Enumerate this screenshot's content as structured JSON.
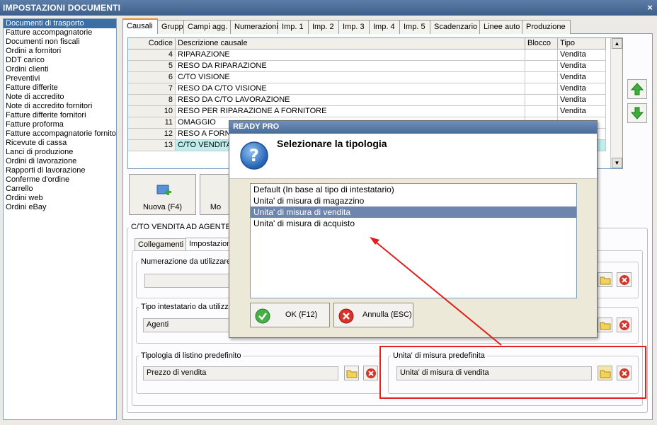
{
  "window": {
    "title": "IMPOSTAZIONI DOCUMENTI",
    "close_glyph": "×"
  },
  "sidebar": {
    "items": [
      "Documenti di trasporto",
      "Fatture accompagnatorie",
      "Documenti non fiscali",
      "Ordini a fornitori",
      "DDT carico",
      "Ordini clienti",
      "Preventivi",
      "Fatture differite",
      "Note di accredito",
      "Note di accredito fornitori",
      "Fatture differite fornitori",
      "Fatture proforma",
      "Fatture accompagnatorie fornitori",
      "Ricevute di cassa",
      "Lanci di produzione",
      "Ordini di lavorazione",
      "Rapporti di lavorazione",
      "Conferme d'ordine",
      "Carrello",
      "Ordini web",
      "Ordini eBay"
    ],
    "selected": "Documenti di trasporto"
  },
  "tabs": [
    "Causali",
    "Gruppi",
    "Campi agg.",
    "Numerazioni",
    "Imp. 1",
    "Imp. 2",
    "Imp. 3",
    "Imp. 4",
    "Imp. 5",
    "Scadenzario",
    "Linee auto",
    "Produzione"
  ],
  "active_tab": "Causali",
  "grid": {
    "headers": {
      "codice": "Codice",
      "descrizione": "Descrizione causale",
      "blocco": "Blocco",
      "tipo": "Tipo"
    },
    "rows": [
      {
        "codice": "4",
        "descrizione": "RIPARAZIONE",
        "blocco": "",
        "tipo": "Vendita"
      },
      {
        "codice": "5",
        "descrizione": "RESO DA RIPARAZIONE",
        "blocco": "",
        "tipo": "Vendita"
      },
      {
        "codice": "6",
        "descrizione": "C/TO VISIONE",
        "blocco": "",
        "tipo": "Vendita"
      },
      {
        "codice": "7",
        "descrizione": "RESO DA C/TO VISIONE",
        "blocco": "",
        "tipo": "Vendita"
      },
      {
        "codice": "8",
        "descrizione": "RESO DA C/TO LAVORAZIONE",
        "blocco": "",
        "tipo": "Vendita"
      },
      {
        "codice": "10",
        "descrizione": "RESO PER RIPARAZIONE A FORNITORE",
        "blocco": "",
        "tipo": "Vendita"
      },
      {
        "codice": "11",
        "descrizione": "OMAGGIO",
        "blocco": "",
        "tipo": ""
      },
      {
        "codice": "12",
        "descrizione": "RESO A FORNI",
        "blocco": "",
        "tipo": ""
      },
      {
        "codice": "13",
        "descrizione": "C/TO VENDITA",
        "blocco": "",
        "tipo": ""
      }
    ]
  },
  "actions": {
    "nuova_label": "Nuova (F4)",
    "modifica_label": "Mo"
  },
  "detail": {
    "title": "C/TO VENDITA AD AGENTE",
    "subtabs": [
      "Collegamenti",
      "Impostazion"
    ],
    "numerazione_title": "Numerazione da utilizzare",
    "numerazione_value": "",
    "tipo_intestatario_title": "Tipo intestatario da utilizza",
    "tipo_intestatario_value": "Agenti",
    "listino_title": "Tipologia di listino predefinito",
    "listino_value": "Prezzo di vendita",
    "unita_title": "Unita' di misura predefinita",
    "unita_value": "Unita' di misura di vendita"
  },
  "dialog": {
    "title": "READY PRO",
    "heading": "Selezionare la tipologia",
    "options": [
      "Default (In base al tipo di intestatario)",
      "Unita' di misura di magazzino",
      "Unita' di misura di vendita",
      "Unita' di misura di acquisto"
    ],
    "selected_index": 2,
    "ok_label": "OK (F12)",
    "cancel_label": "Annulla (ESC)"
  },
  "colors": {
    "highlight_box": "#e0201c",
    "selection": "#3a6ea5",
    "annotation_arrow": "#e0201c"
  },
  "icons": [
    "close-icon",
    "add-document-icon",
    "arrow-up-icon",
    "arrow-down-icon",
    "question-icon",
    "folder-icon",
    "delete-icon",
    "ok-check-icon",
    "cancel-icon"
  ]
}
